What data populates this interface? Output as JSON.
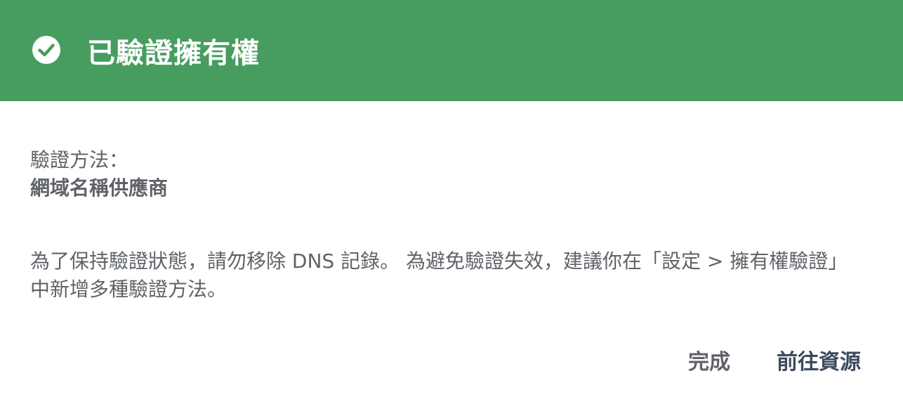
{
  "header": {
    "title": "已驗證擁有權",
    "icon": "check-circle-icon",
    "background_color": "#469d5f"
  },
  "body": {
    "method_label": "驗證方法：",
    "method_value": "網域名稱供應商",
    "notice": "為了保持驗證狀態，請勿移除 DNS 記錄。 為避免驗證失效，建議你在「設定 > 擁有權驗證」中新增多種驗證方法。"
  },
  "actions": {
    "done_label": "完成",
    "go_to_property_label": "前往資源"
  }
}
